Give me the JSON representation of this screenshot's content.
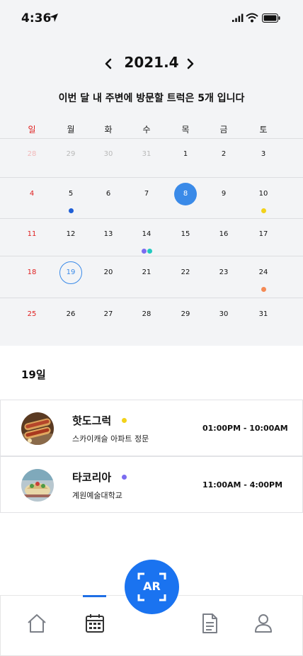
{
  "status_bar": {
    "time": "4:36"
  },
  "calendar": {
    "month_title": "2021.4",
    "summary": "이번 달 내 주변에 방문할 트럭은 5개 입니다",
    "weekdays": [
      "일",
      "월",
      "화",
      "수",
      "목",
      "금",
      "토"
    ],
    "weeks": [
      [
        "28",
        "29",
        "30",
        "31",
        "1",
        "2",
        "3"
      ],
      [
        "4",
        "5",
        "6",
        "7",
        "8",
        "9",
        "10"
      ],
      [
        "11",
        "12",
        "13",
        "14",
        "15",
        "16",
        "17"
      ],
      [
        "18",
        "19",
        "20",
        "21",
        "22",
        "23",
        "24"
      ],
      [
        "25",
        "26",
        "27",
        "28",
        "29",
        "30",
        "31"
      ]
    ],
    "today": "8",
    "selected": "19",
    "event_dots": [
      {
        "day": "5",
        "colors": [
          "#1f5fd6"
        ]
      },
      {
        "day": "10",
        "colors": [
          "#f2d21b"
        ]
      },
      {
        "day": "14",
        "colors": [
          "#7b6cf0",
          "#22c9c0"
        ]
      },
      {
        "day": "24",
        "colors": [
          "#f48a55"
        ]
      }
    ]
  },
  "selected_date_label": "19일",
  "trucks": [
    {
      "name": "핫도그럭",
      "address": "스카이캐슬 아파트 정문",
      "hours": "01:00PM - 10:00AM",
      "dot_color": "#f2d21b",
      "thumb": "hotdog-thumbnail"
    },
    {
      "name": "타코리아",
      "address": "계원예술대학교",
      "hours": "11:00AM - 4:00PM",
      "dot_color": "#7b6cf0",
      "thumb": "taco-thumbnail"
    }
  ],
  "ar_button": {
    "label": "AR"
  },
  "colors": {
    "accent": "#1a73f0",
    "today": "#3a8ae8",
    "sunday": "#e02020"
  },
  "bottom_nav": {
    "items": [
      {
        "icon": "home-icon"
      },
      {
        "icon": "calendar-icon",
        "active": true
      },
      {
        "icon": "document-icon"
      },
      {
        "icon": "profile-icon"
      }
    ]
  }
}
